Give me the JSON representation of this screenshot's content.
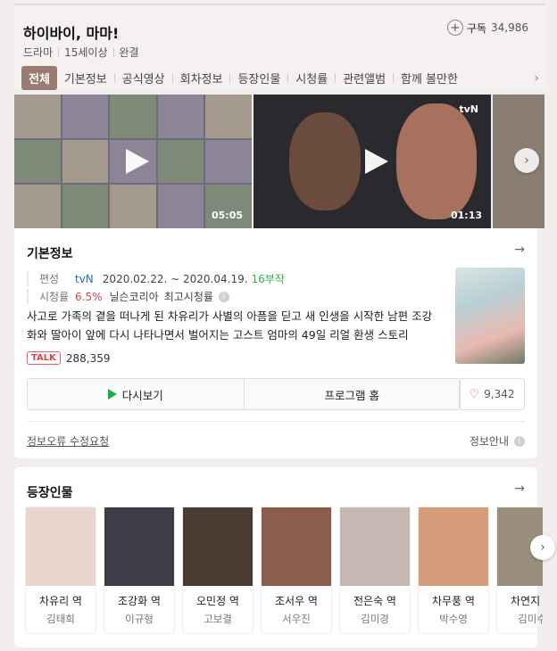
{
  "header": {
    "title": "하이바이, 마마!",
    "meta": [
      "드라마",
      "15세이상",
      "완결"
    ],
    "subscribe_label": "구독",
    "subscribe_count": "34,986"
  },
  "tabs": [
    "전체",
    "기본정보",
    "공식영상",
    "회차정보",
    "등장인물",
    "시청률",
    "관련앨범",
    "함께 볼만한"
  ],
  "videos": [
    {
      "duration": "05:05"
    },
    {
      "duration": "01:13",
      "channel": "tvN"
    },
    {
      "duration": ""
    }
  ],
  "info": {
    "section_title": "기본정보",
    "broadcast_label": "편성",
    "network": "tvN",
    "dates": "2020.02.22. ~ 2020.04.19.",
    "episodes": "16부작",
    "rating_label": "시청률",
    "rating": "6.5%",
    "rating_source": "닐슨코리아",
    "rating_note": "최고시청률",
    "description": "사고로 가족의 곁을 떠나게 된 차유리가 사별의 아픔을 딛고 새 인생을 시작한 남편 조강화와 딸아이 앞에 다시 나타나면서 벌어지는 고스트 엄마의 49일 리얼 환생 스토리",
    "talk_badge": "TALK",
    "talk_count": "288,359",
    "rewatch_label": "다시보기",
    "program_home_label": "프로그램 홈",
    "like_count": "9,342",
    "report_label": "정보오류 수정요청",
    "guide_label": "정보안내"
  },
  "cast": {
    "section_title": "등장인물",
    "members": [
      {
        "role": "차유리 역",
        "actor": "김태희",
        "color": "#e8d6cf"
      },
      {
        "role": "조강화 역",
        "actor": "이규형",
        "color": "#3f3c45"
      },
      {
        "role": "오민정 역",
        "actor": "고보결",
        "color": "#4a3b33"
      },
      {
        "role": "조서우 역",
        "actor": "서우진",
        "color": "#8b5d4f"
      },
      {
        "role": "전은숙 역",
        "actor": "김미경",
        "color": "#c7b7b1"
      },
      {
        "role": "차무풍 역",
        "actor": "박수영",
        "color": "#d59c7a"
      },
      {
        "role": "차연지 역",
        "actor": "김미수",
        "color": "#9a8f7c"
      }
    ]
  },
  "icons": {
    "subscribe": "plus-circle-icon",
    "tabs_next": "chevron-right-icon",
    "play": "play-icon",
    "arrow": "arrow-right-icon",
    "info": "info-icon",
    "heart": "heart-icon"
  }
}
